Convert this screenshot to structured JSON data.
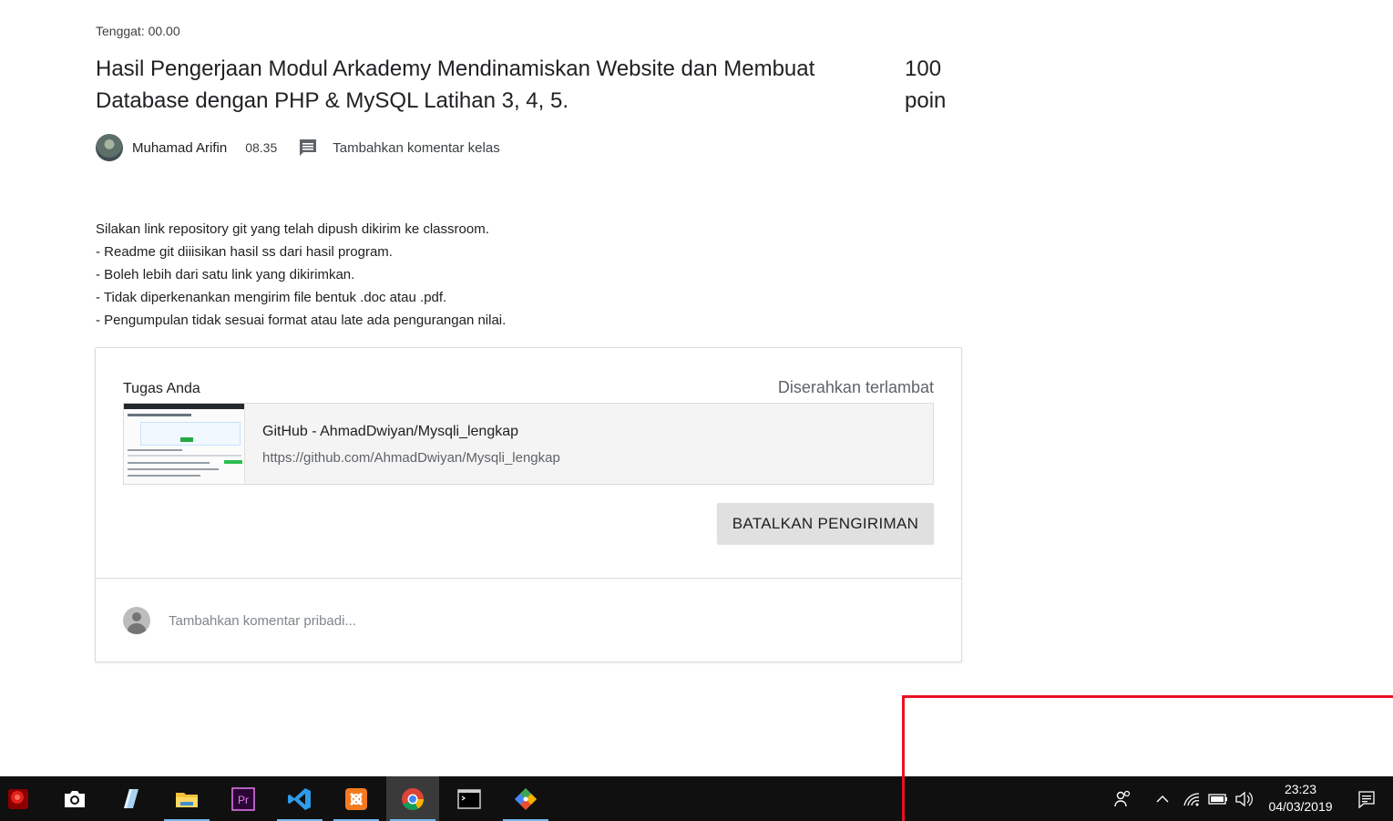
{
  "assignment": {
    "due": "Tenggat: 00.00",
    "title": "Hasil Pengerjaan Modul Arkademy Mendinamiskan Website dan Membuat Database dengan PHP & MySQL Latihan 3, 4, 5.",
    "points": "100 poin",
    "author": "Muhamad Arifin",
    "posted_time": "08.35",
    "class_comment_label": "Tambahkan komentar kelas",
    "description": [
      "Silakan link repository git yang telah dipush dikirim ke classroom.",
      "- Readme git diiisikan hasil ss dari hasil program.",
      "- Boleh lebih dari satu link yang dikirimkan.",
      "- Tidak diperkenankan mengirim file bentuk .doc atau .pdf.",
      "- Pengumpulan tidak sesuai format atau late ada pengurangan nilai."
    ]
  },
  "work_card": {
    "heading": "Tugas Anda",
    "status": "Diserahkan terlambat",
    "attachment": {
      "title": "GitHub - AhmadDwiyan/Mysqli_lengkap",
      "url": "https://github.com/AhmadDwiyan/Mysqli_lengkap"
    },
    "unsubmit_label": "BATALKAN PENGIRIMAN",
    "private_comment_placeholder": "Tambahkan komentar pribadi..."
  },
  "taskbar": {
    "apps": [
      {
        "icon": "red-app-icon",
        "active": false
      },
      {
        "icon": "camera-icon",
        "active": false
      },
      {
        "icon": "notepad-icon",
        "active": false
      },
      {
        "icon": "file-explorer-icon",
        "active": false
      },
      {
        "icon": "premiere-pro-icon",
        "active": false
      },
      {
        "icon": "vscode-icon",
        "active": false
      },
      {
        "icon": "xampp-icon",
        "active": false
      },
      {
        "icon": "chrome-icon",
        "active": true
      },
      {
        "icon": "terminal-icon",
        "active": false
      },
      {
        "icon": "git-icon",
        "active": false
      }
    ],
    "clock_time": "23:23",
    "clock_date": "04/03/2019",
    "colors": {
      "taskbar": "#101010",
      "accent": "#76b9ed",
      "highlight": "#e81123"
    }
  }
}
